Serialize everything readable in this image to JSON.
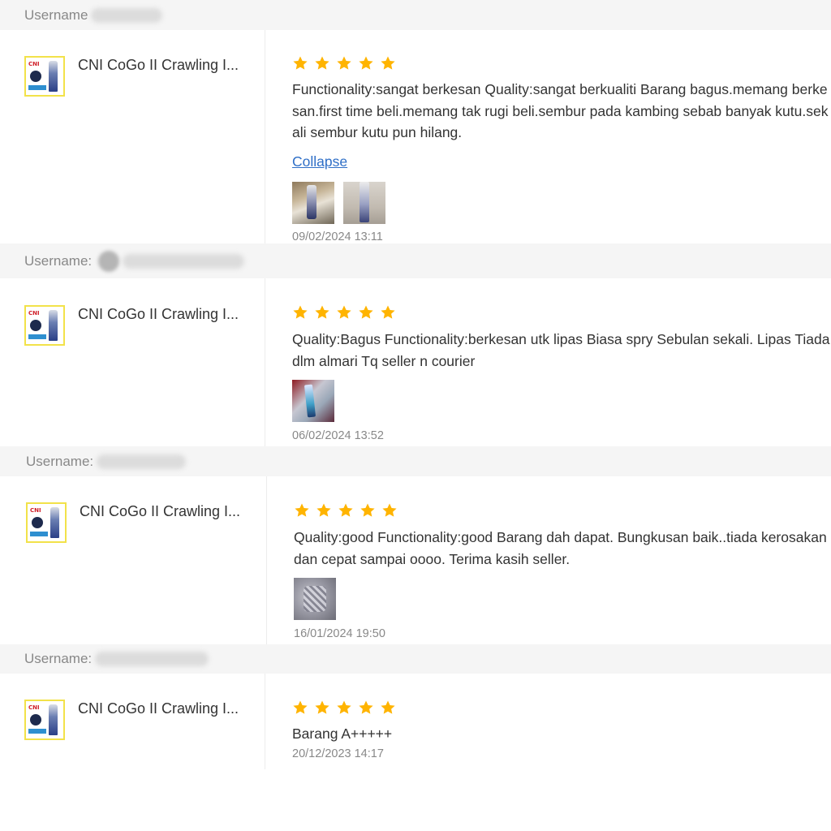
{
  "reviews": [
    {
      "username_label": "Username",
      "product_name": "CNI CoGo II Crawling I...",
      "rating": 5,
      "text": "Functionality:sangat berkesan Quality:sangat berkualiti Barang bagus.memang berkesan.first time beli.memang tak rugi beli.sembur pada kambing sebab banyak kutu.sekali sembur kutu pun hilang.",
      "collapse_label": "Collapse",
      "photos": [
        "photo1",
        "photo2"
      ],
      "timestamp": "09/02/2024 13:11"
    },
    {
      "username_label": "Username:",
      "product_name": "CNI CoGo II Crawling I...",
      "rating": 5,
      "text": "Quality:Bagus Functionality:berkesan utk lipas Biasa spry Sebulan sekali. Lipas Tiada dlm almari Tq seller n courier",
      "photos": [
        "photo3"
      ],
      "timestamp": "06/02/2024 13:52"
    },
    {
      "username_label": "Username:",
      "product_name": "CNI CoGo II Crawling I...",
      "rating": 5,
      "text": "Quality:good Functionality:good Barang dah dapat. Bungkusan baik..tiada kerosakan dan cepat sampai oooo. Terima kasih seller.",
      "photos": [
        "photo4"
      ],
      "timestamp": "16/01/2024 19:50"
    },
    {
      "username_label": "Username:",
      "product_name": "CNI CoGo II Crawling I...",
      "rating": 5,
      "text": "Barang A+++++",
      "photos": [],
      "timestamp": "20/12/2023 14:17"
    }
  ],
  "colors": {
    "star": "#FFB400",
    "link": "#2F6FC7",
    "header_bg": "#F5F5F5",
    "thumb_border": "#F2E24A"
  },
  "icons": {
    "rating": "star-icon",
    "product": "product-thumbnail"
  }
}
